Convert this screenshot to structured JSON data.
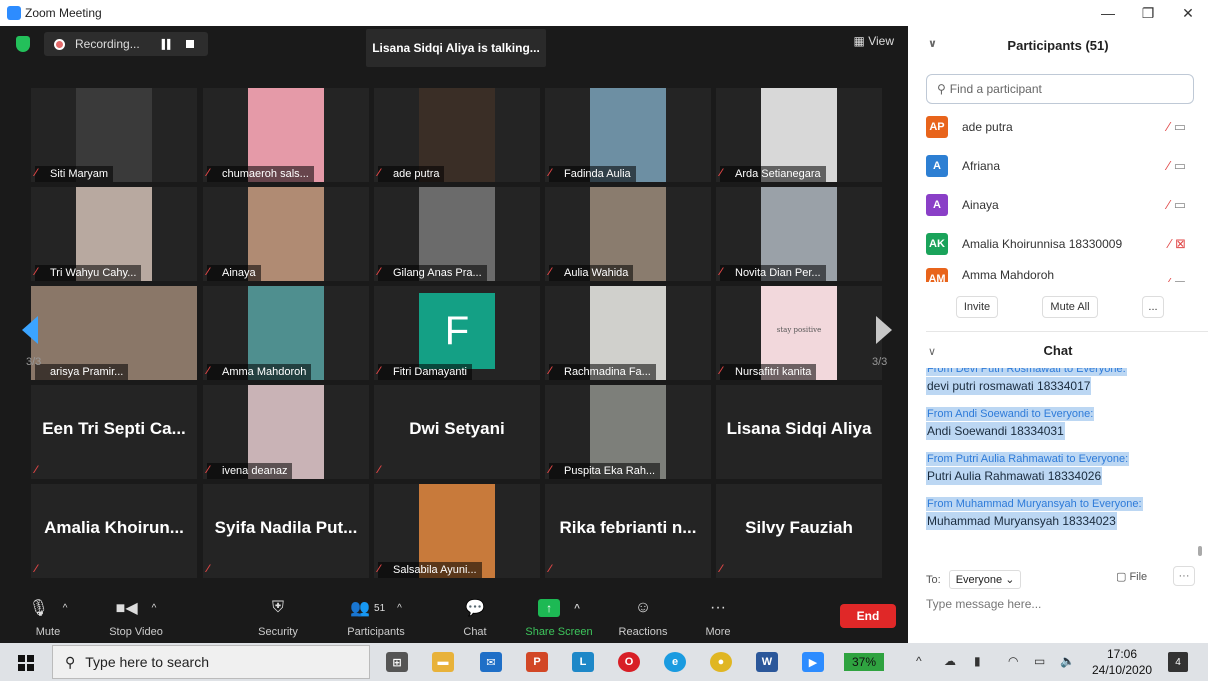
{
  "window": {
    "title": "Zoom Meeting",
    "minimize": "—",
    "restore": "❐",
    "close": "✕"
  },
  "top_bar": {
    "recording": "Recording...",
    "pause": "▌▌",
    "talking": "Lisana Sidqi Aliya is talking...",
    "view": "View"
  },
  "pager": {
    "left": "3/3",
    "right": "3/3"
  },
  "tiles": [
    {
      "name": "Siti Maryam",
      "mic_off": true,
      "video": true,
      "photo_color": "#3a3a3a"
    },
    {
      "name": "chumaeroh sals...",
      "mic_off": true,
      "video": true,
      "photo_color": "#e59aa8"
    },
    {
      "name": "ade putra",
      "mic_off": true,
      "video": true,
      "photo_color": "#3a2e26"
    },
    {
      "name": "Fadinda Aulia",
      "mic_off": true,
      "video": true,
      "photo_color": "#6d8fa3"
    },
    {
      "name": "Arda Setianegara",
      "mic_off": true,
      "video": true,
      "photo_color": "#d8d8d8"
    },
    {
      "name": "Tri Wahyu Cahy...",
      "mic_off": true,
      "video": true,
      "photo_color": "#b8a9a0"
    },
    {
      "name": "Ainaya",
      "mic_off": true,
      "video": true,
      "photo_color": "#b08b73"
    },
    {
      "name": "Gilang Anas Pra...",
      "mic_off": true,
      "video": true,
      "photo_color": "#6b6b6b"
    },
    {
      "name": "Aulia Wahida",
      "mic_off": true,
      "video": true,
      "photo_color": "#8a7c6e"
    },
    {
      "name": "Novita Dian Per...",
      "mic_off": true,
      "video": true,
      "photo_color": "#9aa1a8"
    },
    {
      "name": "arisya Pramir...",
      "mic_off": false,
      "video": true,
      "photo_color": "#8a7768"
    },
    {
      "name": "Amma Mahdoroh",
      "mic_off": true,
      "video": true,
      "photo_color": "#4f8f8f"
    },
    {
      "name": "Fitri Damayanti",
      "mic_off": true,
      "video": false,
      "avatar_letter": "F"
    },
    {
      "name": "Rachmadina Fa...",
      "mic_off": true,
      "video": true,
      "photo_color": "#d0d0cc"
    },
    {
      "name": "Nursafitri kanita",
      "mic_off": true,
      "video": true,
      "photo_color": "#f2d8dc",
      "photo_text": "stay positive"
    },
    {
      "name": "Een Tri Septi Ca...",
      "mic_off": true,
      "video": false,
      "big": true
    },
    {
      "name": "ivena deanaz",
      "mic_off": true,
      "video": true,
      "photo_color": "#c9b3b6"
    },
    {
      "name": "Dwi Setyani",
      "mic_off": true,
      "video": false,
      "big": true
    },
    {
      "name": "Puspita Eka Rah...",
      "mic_off": true,
      "video": true,
      "photo_color": "#7d7f7a"
    },
    {
      "name": "Lisana Sidqi Aliya",
      "mic_off": false,
      "video": false,
      "big": true
    },
    {
      "name": "Amalia Khoirun...",
      "mic_off": true,
      "video": false,
      "big": true
    },
    {
      "name": "Syifa Nadila Put...",
      "mic_off": true,
      "video": false,
      "big": true
    },
    {
      "name": "Salsabila Ayuni...",
      "mic_off": true,
      "video": true,
      "photo_color": "#c87a3b"
    },
    {
      "name": "Rika febrianti n...",
      "mic_off": true,
      "video": false,
      "big": true
    },
    {
      "name": "Silvy Fauziah",
      "mic_off": true,
      "video": false,
      "big": true
    }
  ],
  "toolbar": {
    "mute": "Mute",
    "stop_video": "Stop Video",
    "security": "Security",
    "participants": "Participants",
    "participants_count": "51",
    "chat": "Chat",
    "share_screen": "Share Screen",
    "reactions": "Reactions",
    "more": "More",
    "end": "End"
  },
  "participants_panel": {
    "title": "Participants (51)",
    "search_placeholder": "Find a participant",
    "items": [
      {
        "initials": "AP",
        "name": "ade putra",
        "color": "#e8641b",
        "video_off": false
      },
      {
        "initials": "A",
        "name": "Afriana",
        "color": "#2d7fd3",
        "video_off": false
      },
      {
        "initials": "A",
        "name": "Ainaya",
        "color": "#8a3fc7",
        "video_off": false
      },
      {
        "initials": "AK",
        "name": "Amalia Khoirunnisa 18330009",
        "color": "#1aa35a",
        "video_off": true
      },
      {
        "initials": "AM",
        "name": "Amma Mahdoroh",
        "color": "#e8641b",
        "video_off": false
      }
    ],
    "invite": "Invite",
    "mute_all": "Mute All",
    "more": "..."
  },
  "chat_panel": {
    "title": "Chat",
    "messages": [
      {
        "from": "From Devi Putri Rosmawati to Everyone:",
        "text": "devi putri rosmawati 18334017"
      },
      {
        "from": "From Andi Soewandi to Everyone:",
        "text": "Andi Soewandi 18334031"
      },
      {
        "from": "From Putri Aulia Rahmawati to Everyone:",
        "text": "Putri Aulia Rahmawati 18334026"
      },
      {
        "from": "From Muhammad Muryansyah to Everyone:",
        "text": "Muhammad Muryansyah 18334023"
      }
    ],
    "to_label": "To:",
    "to_value": "Everyone",
    "file": "File",
    "more": "···",
    "input_placeholder": "Type message here..."
  },
  "taskbar": {
    "search_placeholder": "Type here to search",
    "battery": "37%",
    "time": "17:06",
    "date": "24/10/2020",
    "notifications": "4"
  }
}
